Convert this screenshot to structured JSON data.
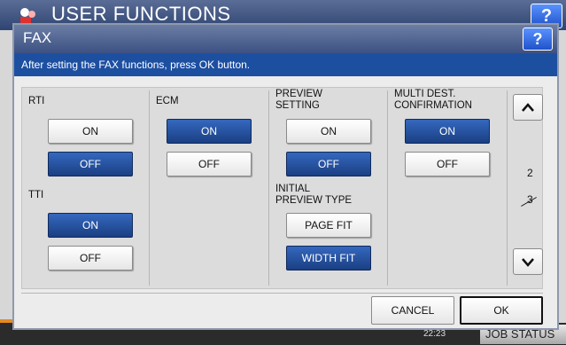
{
  "background_window": {
    "title": "USER FUNCTIONS",
    "help_label": "?",
    "clock": "22:23",
    "job_status_label": "JOB STATUS"
  },
  "dialog": {
    "title": "FAX",
    "help_label": "?",
    "message": "After setting the FAX functions, press OK button."
  },
  "settings": {
    "rti": {
      "label": "RTI",
      "on_label": "ON",
      "off_label": "OFF",
      "selected": "OFF"
    },
    "tti": {
      "label": "TTI",
      "on_label": "ON",
      "off_label": "OFF",
      "selected": "ON"
    },
    "ecm": {
      "label": "ECM",
      "on_label": "ON",
      "off_label": "OFF",
      "selected": "ON"
    },
    "preview_setting": {
      "label_line1": "PREVIEW",
      "label_line2": "SETTING",
      "on_label": "ON",
      "off_label": "OFF",
      "selected": "OFF"
    },
    "initial_preview_type": {
      "label_line1": "INITIAL",
      "label_line2": "PREVIEW TYPE",
      "page_fit_label": "PAGE FIT",
      "width_fit_label": "WIDTH FIT",
      "selected": "WIDTH FIT"
    },
    "multi_dest_confirmation": {
      "label_line1": "MULTI DEST.",
      "label_line2": "CONFIRMATION",
      "on_label": "ON",
      "off_label": "OFF",
      "selected": "ON"
    }
  },
  "pagination": {
    "current": "2",
    "total": "3"
  },
  "footer": {
    "cancel_label": "CANCEL",
    "ok_label": "OK"
  },
  "colors": {
    "selected": "#1f4a95",
    "unselected": "#f4f4f4",
    "message_bar": "#1d4fa1",
    "title_bar": "#4a5f8e"
  }
}
